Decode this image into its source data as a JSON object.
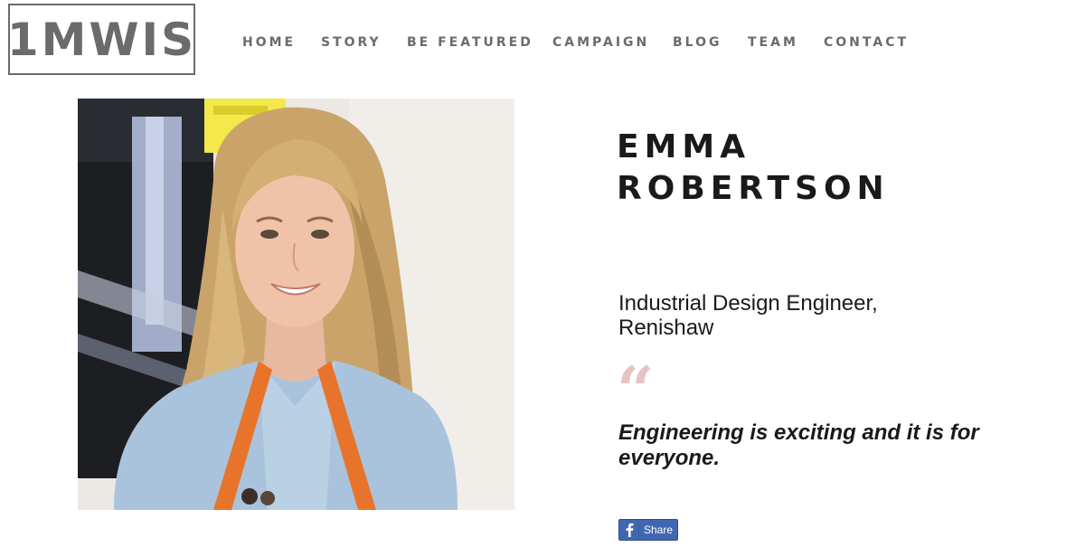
{
  "brand": {
    "logo_text": "1MWIS"
  },
  "nav": {
    "items": [
      {
        "label": "HOME"
      },
      {
        "label": "STORY"
      },
      {
        "label": "BE FEATURED"
      },
      {
        "label": "CAMPAIGN"
      },
      {
        "label": "BLOG"
      },
      {
        "label": "TEAM"
      },
      {
        "label": "CONTACT"
      }
    ]
  },
  "profile": {
    "name_line1": "EMMA",
    "name_line2": "ROBERTSON",
    "role_line1": "Industrial Design Engineer,",
    "role_line2": "Renishaw",
    "quote_mark": "“",
    "quote": "Engineering is exciting and it is for everyone."
  },
  "share": {
    "label": "Share",
    "icon": "facebook-icon"
  },
  "colors": {
    "nav_text": "#6b6b6b",
    "quote_mark": "#e6c4c4",
    "share_button": "#4267b2",
    "lanyard": "#e8742c"
  }
}
